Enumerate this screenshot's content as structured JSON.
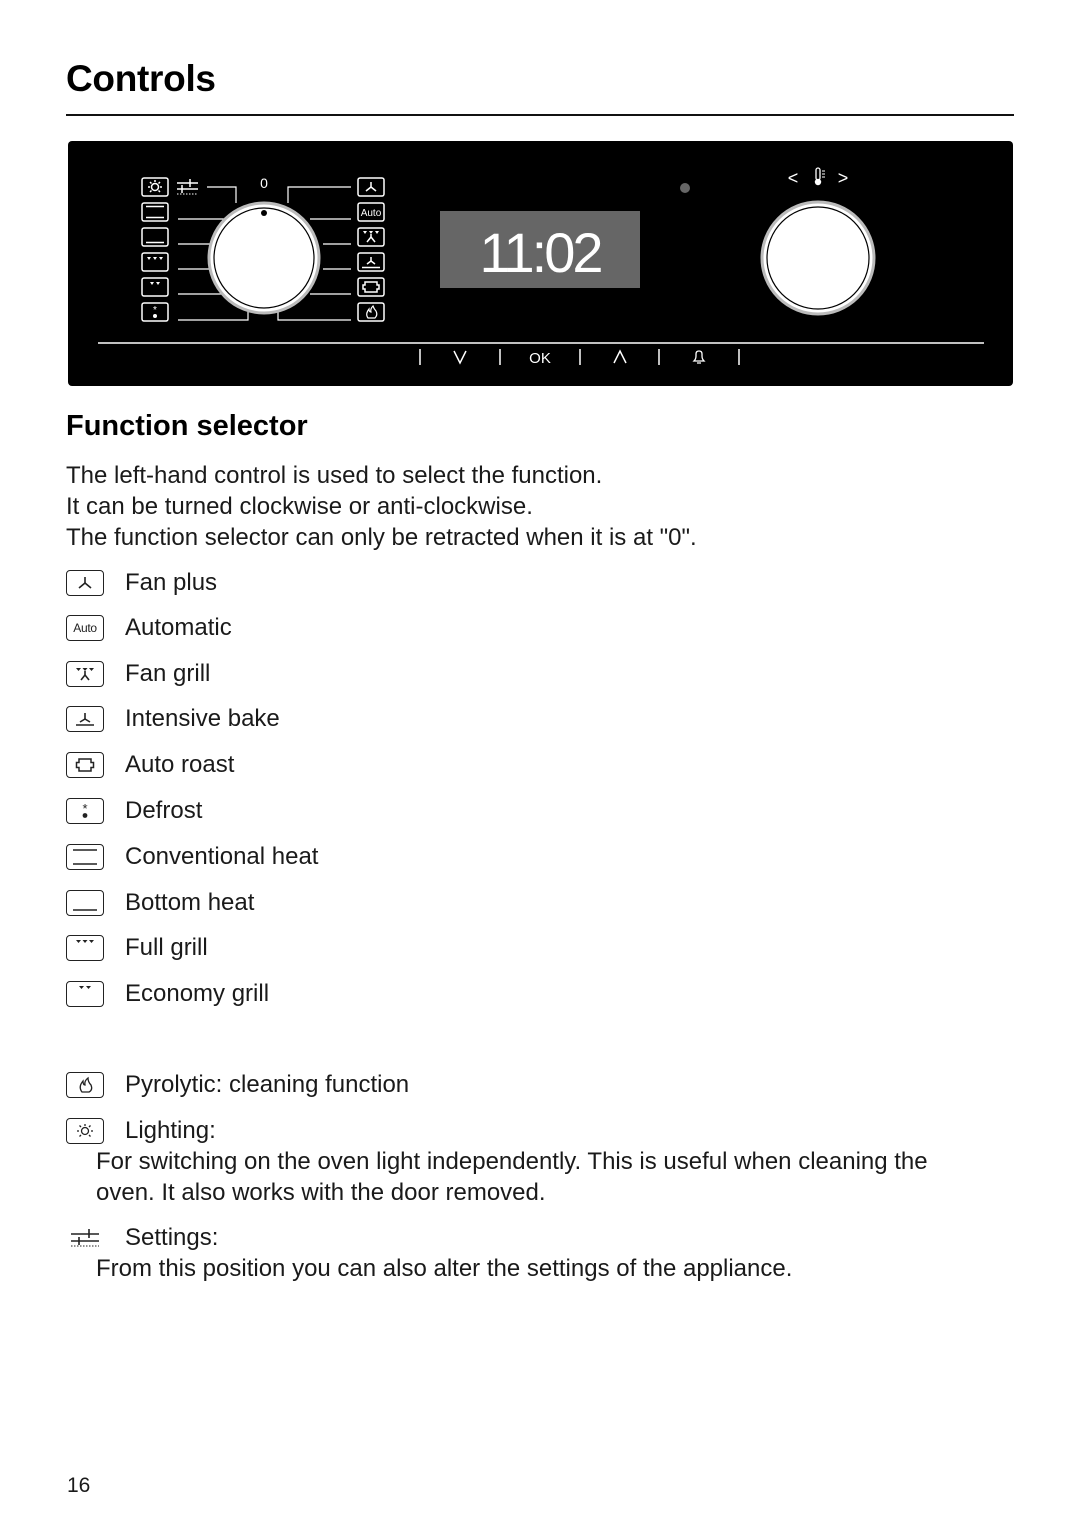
{
  "page": {
    "title": "Controls",
    "page_number": "16"
  },
  "panel": {
    "zero_label": "0",
    "display_time": "11:02",
    "temp_left": "<",
    "temp_right": ">",
    "sensor_buttons": [
      {
        "label": "V",
        "icon": "chevron-down-icon"
      },
      {
        "label": "OK",
        "icon": null
      },
      {
        "label": "Λ",
        "icon": "chevron-up-icon"
      },
      {
        "label": "",
        "icon": "bell-icon"
      }
    ],
    "left_icons": [
      "lighting-icon",
      "conventional-heat-icon",
      "bottom-heat-icon",
      "full-grill-icon",
      "economy-grill-icon",
      "defrost-icon"
    ],
    "right_icons": [
      "fan-plus-icon",
      "automatic-icon",
      "fan-grill-icon",
      "intensive-bake-icon",
      "auto-roast-icon",
      "pyrolytic-icon"
    ],
    "auto_label": "Auto"
  },
  "section": {
    "title": "Function selector",
    "intro": [
      "The left-hand control is used to select the function.",
      "It can be turned clockwise or anti-clockwise.",
      "The function selector can only be retracted when it is at \"0\"."
    ]
  },
  "functions": [
    {
      "icon": "fan-plus-icon",
      "label": "Fan plus"
    },
    {
      "icon": "automatic-icon",
      "label": "Automatic",
      "icon_text": "Auto"
    },
    {
      "icon": "fan-grill-icon",
      "label": "Fan grill"
    },
    {
      "icon": "intensive-bake-icon",
      "label": "Intensive bake"
    },
    {
      "icon": "auto-roast-icon",
      "label": "Auto roast"
    },
    {
      "icon": "defrost-icon",
      "label": "Defrost"
    },
    {
      "icon": "conventional-heat-icon",
      "label": "Conventional heat"
    },
    {
      "icon": "bottom-heat-icon",
      "label": "Bottom heat"
    },
    {
      "icon": "full-grill-icon",
      "label": "Full grill"
    },
    {
      "icon": "economy-grill-icon",
      "label": "Economy grill"
    }
  ],
  "extras": [
    {
      "icon": "pyrolytic-icon",
      "label": "Pyrolytic: cleaning function"
    },
    {
      "icon": "lighting-icon",
      "label": "Lighting:",
      "description": [
        "For switching on the oven light independently. This is useful when cleaning the",
        "oven. It also works with the door removed."
      ]
    },
    {
      "icon": "settings-icon",
      "label": "Settings:",
      "description": [
        "From this position you can also alter the settings of the appliance."
      ]
    }
  ]
}
